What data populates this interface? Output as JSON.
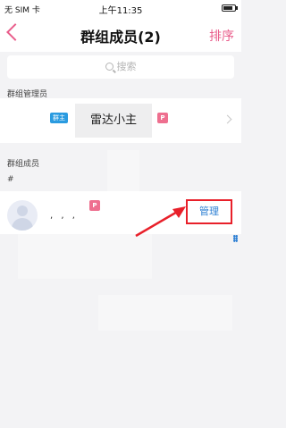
{
  "status_bar": {
    "carrier": "无 SIM 卡",
    "time": "上午11:35"
  },
  "nav": {
    "title": "群组成员(2)",
    "sort_label": "排序",
    "back_icon": "back-chevron-icon"
  },
  "search": {
    "placeholder": "搜索"
  },
  "sections": {
    "admins_label": "群组管理员",
    "members_label": "群组成员",
    "members_index": "#"
  },
  "admin": {
    "badge": "群主",
    "name": "雷达小主",
    "vip_icon": "P"
  },
  "member": {
    "name": ", , ,",
    "vip_icon": "P",
    "manage_label": "管理"
  },
  "colors": {
    "accent": "#e95d8b",
    "badge_blue": "#2a9be0",
    "annotation_red": "#e8202a",
    "link_blue": "#2c7fd3"
  }
}
